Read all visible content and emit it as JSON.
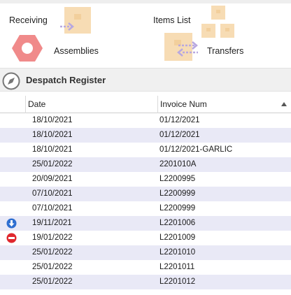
{
  "tiles": {
    "receiving": "Receiving",
    "items_list": "Items List",
    "assemblies": "Assemblies",
    "transfers": "Transfers"
  },
  "section": {
    "title": "Despatch Register"
  },
  "grid": {
    "columns": [
      "Date",
      "Invoice Num"
    ],
    "sorted_column": "Invoice Num",
    "sort_direction": "ascending",
    "rows": [
      {
        "date": "18/10/2021",
        "invoice": "01/12/2021",
        "status_icon": ""
      },
      {
        "date": "18/10/2021",
        "invoice": "01/12/2021",
        "status_icon": ""
      },
      {
        "date": "18/10/2021",
        "invoice": "01/12/2021-GARLIC",
        "status_icon": ""
      },
      {
        "date": "25/01/2022",
        "invoice": "2201010A",
        "status_icon": ""
      },
      {
        "date": "20/09/2021",
        "invoice": "L2200995",
        "status_icon": ""
      },
      {
        "date": "07/10/2021",
        "invoice": "L2200999",
        "status_icon": ""
      },
      {
        "date": "07/10/2021",
        "invoice": "L2200999",
        "status_icon": ""
      },
      {
        "date": "19/11/2021",
        "invoice": "L2201006",
        "status_icon": "download-arrow-icon"
      },
      {
        "date": "19/01/2022",
        "invoice": "L2201009",
        "status_icon": "no-entry-icon"
      },
      {
        "date": "25/01/2022",
        "invoice": "L2201010",
        "status_icon": ""
      },
      {
        "date": "25/01/2022",
        "invoice": "L2201011",
        "status_icon": ""
      },
      {
        "date": "25/01/2022",
        "invoice": "L2201012",
        "status_icon": ""
      }
    ]
  },
  "colors": {
    "row_alt": "#e9e9f6",
    "tile_box": "#f7dcb4",
    "tile_arrow": "#b8a8e0",
    "assembly_icon": "#f08a8a",
    "blue_icon": "#2f6fd0",
    "red_icon": "#e0282e"
  }
}
